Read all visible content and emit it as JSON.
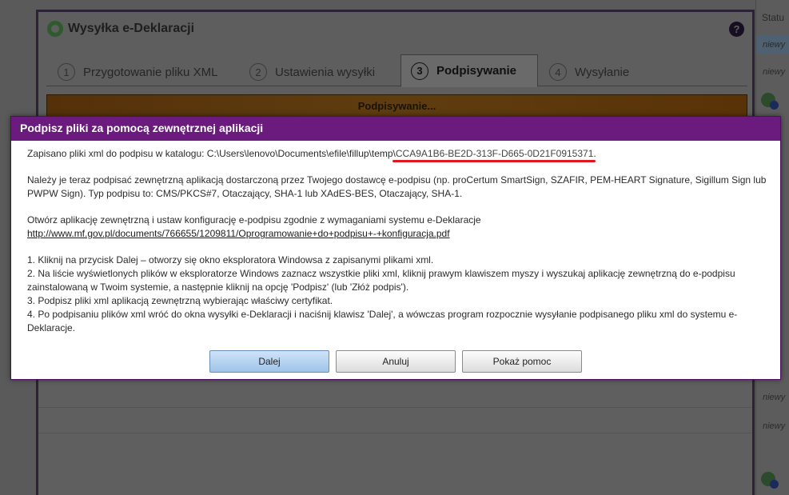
{
  "background": {
    "status_header": "Statu",
    "rows": [
      "niewy",
      "niewy",
      "niewy",
      "niewy"
    ]
  },
  "main_dialog": {
    "title": "Wysyłka e-Deklaracji",
    "help_icon": "?",
    "tabs": [
      {
        "num": "1",
        "label": "Przygotowanie pliku XML"
      },
      {
        "num": "2",
        "label": "Ustawienia wysyłki"
      },
      {
        "num": "3",
        "label": "Podpisywanie"
      },
      {
        "num": "4",
        "label": "Wysyłanie"
      }
    ],
    "progress_text": "Podpisywanie..."
  },
  "modal": {
    "title": "Podpisz pliki za pomocą zewnętrznej aplikacji",
    "line1_prefix": "Zapisano pliki xml do podpisu w katalogu: C:\\Users\\lenovo\\Documents\\efile\\fillup\\temp\\",
    "line1_guid": "CCA9A1B6-BE2D-313F-D665-0D21F0915371",
    "line1_suffix": ".",
    "para2": "Należy je teraz podpisać zewnętrzną aplikacją dostarczoną przez Twojego dostawcę e-podpisu (np. proCertum SmartSign, SZAFIR, PEM-HEART Signature, Sigillum Sign lub PWPW Sign). Typ podpisu to: CMS/PKCS#7, Otaczający, SHA-1 lub XAdES-BES, Otaczający, SHA-1.",
    "para3_text": "Otwórz aplikację zewnętrzną i ustaw konfigurację e-podpisu zgodnie z wymaganiami systemu e-Deklaracje",
    "para3_link": "http://www.mf.gov.pl/documents/766655/1209811/Oprogramowanie+do+podpisu+-+konfiguracja.pdf",
    "steps": [
      "1. Kliknij na przycisk Dalej – otworzy się okno eksploratora Windowsa z zapisanymi plikami xml.",
      "2. Na liście wyświetlonych plików w eksploratorze Windows zaznacz wszystkie pliki xml, kliknij prawym klawiszem myszy i wyszukaj aplikację zewnętrzną do e-podpisu zainstalowaną w Twoim systemie, a następnie kliknij na opcję 'Podpisz' (lub 'Złóż podpis').",
      "3. Podpisz pliki xml aplikacją zewnętrzną wybierając właściwy certyfikat.",
      "4. Po podpisaniu plików xml wróć do okna wysyłki e-Deklaracji i naciśnij klawisz 'Dalej', a wówczas program rozpocznie wysyłanie podpisanego pliku xml do systemu e-Deklaracje."
    ],
    "buttons": {
      "next": "Dalej",
      "cancel": "Anuluj",
      "help": "Pokaż pomoc"
    }
  }
}
